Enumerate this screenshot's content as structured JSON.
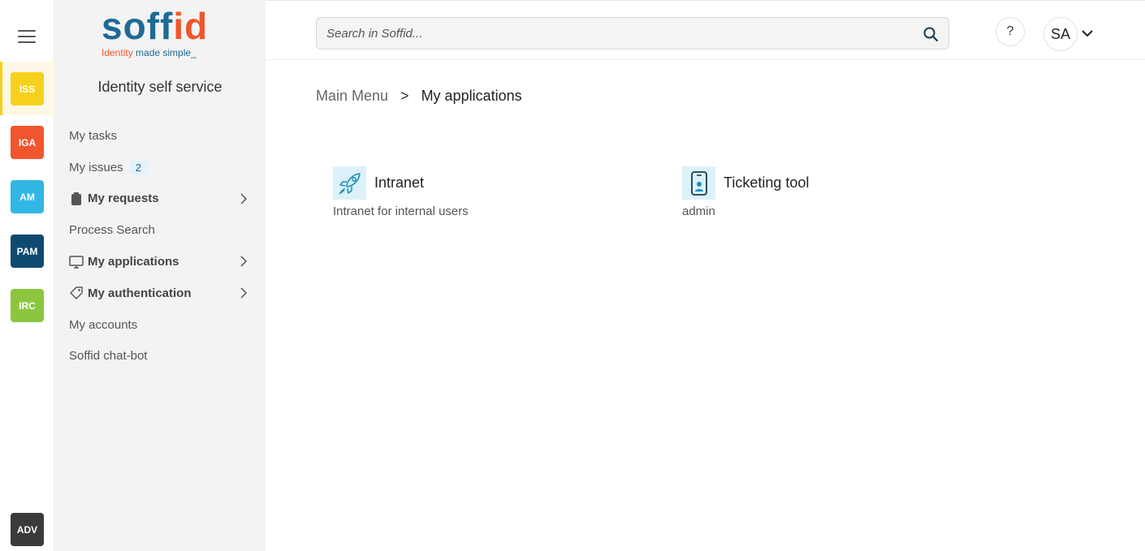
{
  "rail": {
    "modules": [
      {
        "code": "ISS",
        "color": "#f5d11e"
      },
      {
        "code": "IGA",
        "color": "#f0562e"
      },
      {
        "code": "AM",
        "color": "#32b7e4"
      },
      {
        "code": "PAM",
        "color": "#0e4a6f"
      },
      {
        "code": "IRC",
        "color": "#8cc63f"
      },
      {
        "code": "ADV",
        "color": "#3a3a3a"
      }
    ],
    "active": "ISS"
  },
  "logo": {
    "word_part1": "soff",
    "word_part2": "id",
    "tagline_part1": "Identity",
    "tagline_part2": " made simple_"
  },
  "sidebar": {
    "title": "Identity self service",
    "items": [
      {
        "label": "My tasks"
      },
      {
        "label": "My issues",
        "badge": "2"
      },
      {
        "label": "My requests",
        "icon": "clipboard-icon"
      },
      {
        "label": "Process Search"
      },
      {
        "label": "My applications",
        "icon": "monitor-icon"
      },
      {
        "label": "My authentication",
        "icon": "tag-icon"
      },
      {
        "label": "My accounts"
      },
      {
        "label": "Soffid chat-bot"
      }
    ]
  },
  "topbar": {
    "search_placeholder": "Search in Soffid...",
    "help_label": "?",
    "user_initials": "SA"
  },
  "breadcrumb": {
    "root": "Main Menu",
    "separator": ">",
    "current": "My applications"
  },
  "applications": [
    {
      "name": "Intranet",
      "description": "Intranet for internal users",
      "icon": "rocket-icon"
    },
    {
      "name": "Ticketing tool",
      "description": "admin",
      "icon": "mobile-badge-icon"
    }
  ],
  "colors": {
    "brand_blue": "#1d6a94",
    "brand_orange": "#f0562e",
    "accent_icon": "#1d8fb8",
    "app_icon_bg": "#dcf1fa"
  }
}
